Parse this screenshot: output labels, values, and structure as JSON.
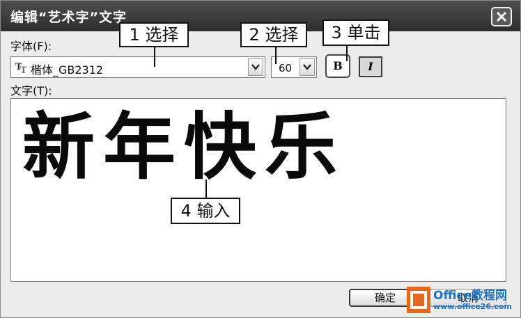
{
  "dialog": {
    "title": "编辑“艺术字”文字",
    "font_label": "字体(F):",
    "font_value": "楷体_GB2312",
    "size_value": "60",
    "bold_label": "B",
    "italic_label": "I",
    "text_label": "文字(T):",
    "text_value": "新年快乐",
    "ok_label": "确定",
    "cancel_label": "取消"
  },
  "callouts": [
    {
      "label": "1 选择"
    },
    {
      "label": "2 选择"
    },
    {
      "label": "3 单击"
    },
    {
      "label": "4 输入"
    }
  ],
  "watermark": {
    "name": "Office教程网",
    "url": "www.office26.com"
  },
  "colors": {
    "titlebar": "#3a3a3a",
    "logo_orange": "#e5671f",
    "logo_blue": "#1e73c8"
  }
}
